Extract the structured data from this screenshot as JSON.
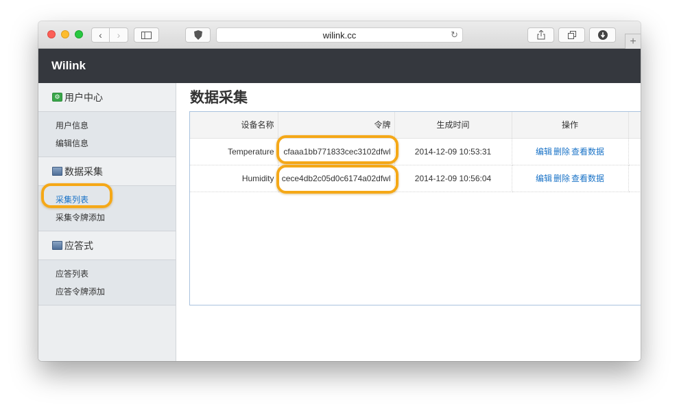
{
  "browser": {
    "back_icon": "‹",
    "forward_icon": "›",
    "sidebar_icon": "sidebar-icon",
    "shield_icon": "shield-icon",
    "url": "wilink.cc",
    "reload_icon": "↻",
    "share_icon": "⇪",
    "tabs_icon": "⧉",
    "download_icon": "⬇",
    "newtab_label": "+"
  },
  "header": {
    "brand": "Wilink"
  },
  "sidebar": {
    "sections": [
      {
        "title": "用户中心",
        "items": [
          "用户信息",
          "编辑信息"
        ]
      },
      {
        "title": "数据采集",
        "items": [
          "采集列表",
          "采集令牌添加"
        ]
      },
      {
        "title": "应答式",
        "items": [
          "应答列表",
          "应答令牌添加"
        ]
      }
    ],
    "active_item": "采集列表"
  },
  "main": {
    "title": "数据采集",
    "columns": [
      "设备名称",
      "令牌",
      "生成时间",
      "操作"
    ],
    "rows": [
      {
        "name": "Temperature",
        "token": "cfaaa1bb771833cec3102dfwl",
        "time": "2014-12-09 10:53:31",
        "ops": [
          "编辑",
          "删除",
          "查看数据"
        ]
      },
      {
        "name": "Humidity",
        "token": "cece4db2c05d0c6174a02dfwl",
        "time": "2014-12-09 10:56:04",
        "ops": [
          "编辑",
          "删除",
          "查看数据"
        ]
      }
    ]
  },
  "colors": {
    "header_bg": "#35383e",
    "link": "#1a73c7",
    "highlight": "#f5a817"
  }
}
